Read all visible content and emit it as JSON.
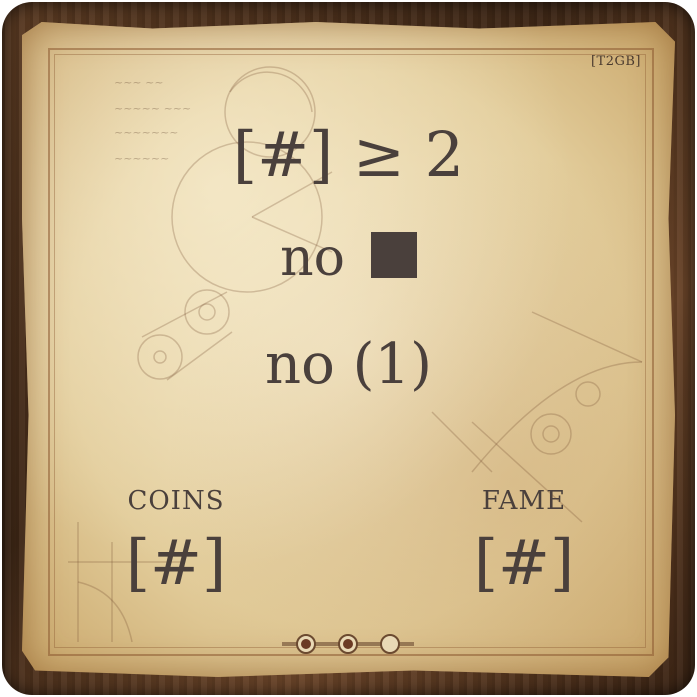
{
  "card": {
    "code": "[T2GB]",
    "line1": "[#] ≥ 2",
    "line2_word": "no",
    "line3": "no (1)",
    "coins": {
      "label": "COINS",
      "value": "[#]"
    },
    "fame": {
      "label": "FAME",
      "value": "[#]"
    },
    "progress_dots": [
      {
        "filled": true
      },
      {
        "filled": true
      },
      {
        "filled": false
      }
    ]
  }
}
